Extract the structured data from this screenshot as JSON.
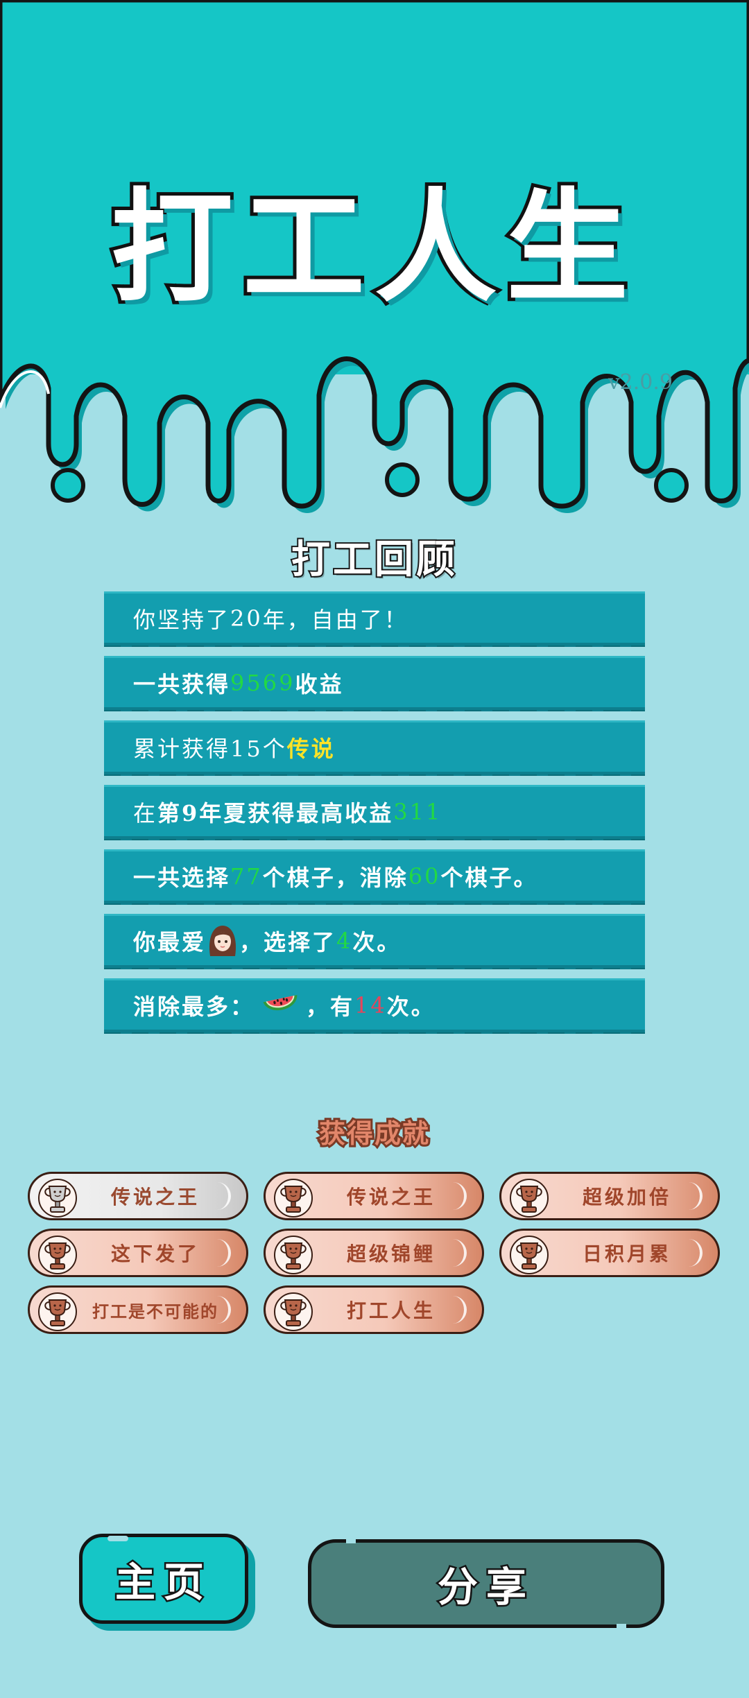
{
  "header": {
    "app_title": "打工人生",
    "version": "v2.0.9"
  },
  "review": {
    "title": "打工回顾",
    "years": {
      "pre": "你坚持了",
      "value": "20",
      "post": "年，自由了！"
    },
    "income": {
      "pre": "一共获得",
      "value": "9569",
      "post": "收益"
    },
    "legend": {
      "pre": "累计获得15个",
      "value": "传说"
    },
    "best": {
      "pre": "在 ",
      "period": "第9年夏",
      "mid": " 获得最高收益",
      "value": "311"
    },
    "pieces": {
      "pre": "一共选择",
      "picked": "77",
      "mid": "个棋子，消除",
      "removed": "60",
      "post": "个棋子。"
    },
    "favorite": {
      "pre": "你最爱",
      "mid": "，选择了",
      "value": "4",
      "post": "次。"
    },
    "most_removed": {
      "pre": "消除最多：",
      "mid": "，有",
      "value": "14",
      "post": "次。"
    }
  },
  "achievements": {
    "title": "获得成就",
    "items": [
      {
        "label": "传说之王",
        "tier": "silver",
        "icon": "trophy-icon"
      },
      {
        "label": "传说之王",
        "tier": "bronze",
        "icon": "trophy-icon"
      },
      {
        "label": "超级加倍",
        "tier": "bronze",
        "icon": "trophy-icon"
      },
      {
        "label": "这下发了",
        "tier": "bronze",
        "icon": "trophy-icon"
      },
      {
        "label": "超级锦鲤",
        "tier": "bronze",
        "icon": "trophy-icon"
      },
      {
        "label": "日积月累",
        "tier": "bronze",
        "icon": "trophy-icon"
      },
      {
        "label": "打工是不可能的",
        "tier": "bronze",
        "icon": "trophy-icon"
      },
      {
        "label": "打工人生",
        "tier": "bronze",
        "icon": "trophy-icon"
      }
    ]
  },
  "buttons": {
    "home": "主页",
    "share": "分享"
  },
  "colors": {
    "background": "#a3dfe6",
    "header": "#15c6c6",
    "row": "#139eaf",
    "highlight_green": "#22d943",
    "highlight_yellow": "#ffe326",
    "highlight_red": "#e8445b",
    "share_button": "#4a7f7b"
  }
}
